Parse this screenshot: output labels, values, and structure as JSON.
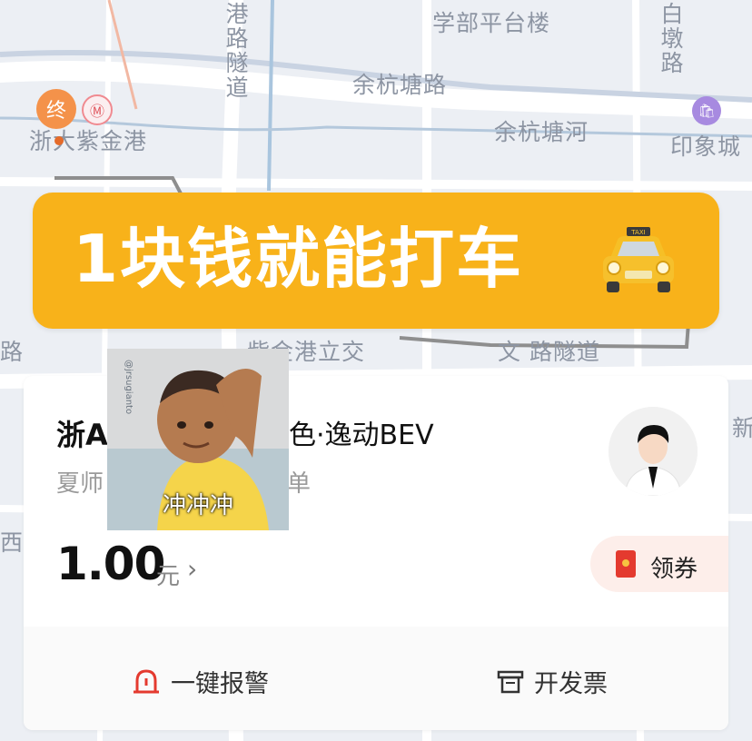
{
  "map": {
    "labels": {
      "xuebu": "学部平台楼",
      "yuhangtang_rd": "余杭塘路",
      "yuhangtang_river": "余杭塘河",
      "yinxiangcheng": "印象城",
      "zijingang": "浙大紫金港",
      "zijingang_interchange": "紫金港立交",
      "wen_tunnel": "文   路隧道",
      "gang_tunnel": "港路隧道",
      "bai_dun": "白墩路",
      "lu_left": "路",
      "xin_right": "新",
      "xi_left": "西"
    },
    "end_pin": "终",
    "metro_icon": "metro-icon",
    "mall_icon": "mall-icon"
  },
  "banner": {
    "text": "1块钱就能打车",
    "icon": "taxi-icon",
    "color": "#f8b21a"
  },
  "trip_card": {
    "plate": "浙A",
    "car_model": "色·逸动BEV",
    "driver": "夏师",
    "order_text": "单",
    "price": "1.00",
    "unit": "元",
    "arrow": "›",
    "coupon_label": "领券",
    "alarm_label": "一键报警",
    "invoice_label": "开发票",
    "accent": "#e43a2f"
  },
  "meme": {
    "caption": "冲冲冲",
    "watermark": "@jrsugianto"
  }
}
